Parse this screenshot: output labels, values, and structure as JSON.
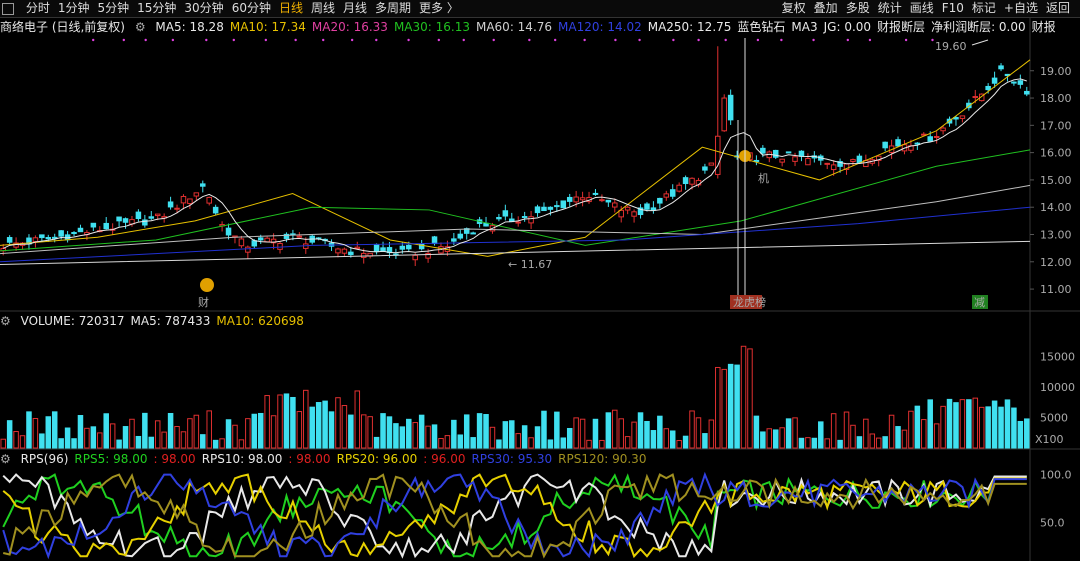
{
  "toolbar": {
    "left_items": [
      "分时",
      "1分钟",
      "5分钟",
      "15分钟",
      "30分钟",
      "60分钟",
      "日线",
      "周线",
      "月线",
      "多周期",
      "更多 〉"
    ],
    "active": "日线",
    "right_items": [
      "复权",
      "叠加",
      "多股",
      "统计",
      "画线",
      "F10",
      "标记",
      "+自选",
      "返回"
    ]
  },
  "legend": {
    "stock": "商络电子 (日线,前复权)",
    "items": [
      {
        "text": "MA5: 18.28",
        "color": "#e8e8e8"
      },
      {
        "text": "MA10: 17.34",
        "color": "#e6c000"
      },
      {
        "text": "MA20: 16.33",
        "color": "#e040a0"
      },
      {
        "text": "MA30: 16.13",
        "color": "#20c020"
      },
      {
        "text": "MA60: 14.76",
        "color": "#cfcfcf"
      },
      {
        "text": "MA120: 14.02",
        "color": "#3040e0"
      },
      {
        "text": "MA250: 12.75",
        "color": "#e8e8e8"
      },
      {
        "text": "蓝色钻石",
        "color": "#e8e8e8"
      },
      {
        "text": "MA3",
        "color": "#e8e8e8"
      },
      {
        "text": "JG: 0.00",
        "color": "#e8e8e8"
      },
      {
        "text": "财报断层",
        "color": "#e8e8e8"
      },
      {
        "text": "净利润断层: 0.00",
        "color": "#e8e8e8"
      },
      {
        "text": "财报",
        "color": "#e8e8e8"
      }
    ]
  },
  "volume_legend": [
    {
      "text": "VOLUME: 720317",
      "color": "#e8e8e8"
    },
    {
      "text": "MA5: 787433",
      "color": "#e8e8e8"
    },
    {
      "text": "MA10: 620698",
      "color": "#e6c000"
    }
  ],
  "rps_legend": [
    {
      "text": "RPS(96)",
      "color": "#e8e8e8"
    },
    {
      "text": "RPS5: 98.00",
      "color": "#20d020"
    },
    {
      "text": ": 98.00",
      "color": "#e02020"
    },
    {
      "text": "RPS10: 98.00",
      "color": "#e8e8e8"
    },
    {
      "text": ": 98.00",
      "color": "#e02020"
    },
    {
      "text": "RPS20: 96.00",
      "color": "#e6d000"
    },
    {
      "text": ": 96.00",
      "color": "#e02020"
    },
    {
      "text": "RPS30: 95.30",
      "color": "#3040e0"
    },
    {
      "text": "RPS120: 90.30",
      "color": "#a09020"
    }
  ],
  "labels": {
    "high": "19.60",
    "low": "11.67",
    "marker_cai": "财",
    "marker_longhu": "龙虎榜",
    "marker_jian": "减",
    "marker_ji": "机",
    "vol_unit": "X100"
  },
  "colors": {
    "up": "#e03030",
    "down": "#40e0f0",
    "ma5": "#e8e8e8",
    "ma10": "#e6c000",
    "ma30": "#20c020",
    "ma60": "#bfbfbf",
    "ma120": "#2030d0",
    "ma250": "#d8d8d8"
  },
  "chart_data": [
    {
      "type": "candlestick",
      "panel": "price",
      "yaxis_ticks": [
        11.0,
        12.0,
        13.0,
        14.0,
        15.0,
        16.0,
        17.0,
        18.0,
        19.0
      ],
      "ylim": [
        10.6,
        20.2
      ],
      "n_bars": 160,
      "series": [
        {
          "name": "MA10",
          "values": [
            [
              0,
              12.6
            ],
            [
              25,
              12.9
            ],
            [
              50,
              13.5
            ],
            [
              75,
              14.5
            ],
            [
              100,
              12.8
            ],
            [
              125,
              12.2
            ],
            [
              150,
              12.9
            ],
            [
              180,
              16.2
            ],
            [
              210,
              15.0
            ],
            [
              240,
              16.8
            ],
            [
              264,
              19.4
            ]
          ]
        },
        {
          "name": "MA30",
          "values": [
            [
              0,
              12.4
            ],
            [
              40,
              12.8
            ],
            [
              80,
              14.0
            ],
            [
              110,
              13.9
            ],
            [
              150,
              12.6
            ],
            [
              190,
              13.5
            ],
            [
              210,
              14.3
            ],
            [
              240,
              15.5
            ],
            [
              264,
              16.1
            ]
          ]
        },
        {
          "name": "MA60",
          "values": [
            [
              0,
              12.3
            ],
            [
              60,
              12.9
            ],
            [
              120,
              13.2
            ],
            [
              180,
              13.0
            ],
            [
              210,
              13.6
            ],
            [
              240,
              14.2
            ],
            [
              264,
              14.8
            ]
          ]
        },
        {
          "name": "MA120",
          "values": [
            [
              0,
              12.0
            ],
            [
              80,
              12.6
            ],
            [
              160,
              12.8
            ],
            [
              220,
              13.4
            ],
            [
              264,
              14.0
            ]
          ]
        },
        {
          "name": "MA250",
          "values": [
            [
              0,
              11.9
            ],
            [
              120,
              12.3
            ],
            [
              264,
              12.75
            ]
          ]
        }
      ]
    },
    {
      "type": "bar",
      "panel": "volume",
      "yaxis_ticks": [
        5000,
        10000,
        15000
      ],
      "ylim": [
        0,
        19000
      ]
    },
    {
      "type": "line",
      "panel": "rps",
      "yaxis_ticks": [
        50.0,
        100.0
      ],
      "ylim": [
        10,
        110
      ],
      "series": [
        {
          "name": "RPS5",
          "color": "#20d020",
          "last": 98.0
        },
        {
          "name": "RPS10",
          "color": "#e8e8e8",
          "last": 98.0
        },
        {
          "name": "RPS20",
          "color": "#e6d000",
          "last": 96.0
        },
        {
          "name": "RPS30",
          "color": "#3040e0",
          "last": 95.3
        },
        {
          "name": "RPS120",
          "color": "#a09020",
          "last": 90.3
        }
      ]
    }
  ]
}
